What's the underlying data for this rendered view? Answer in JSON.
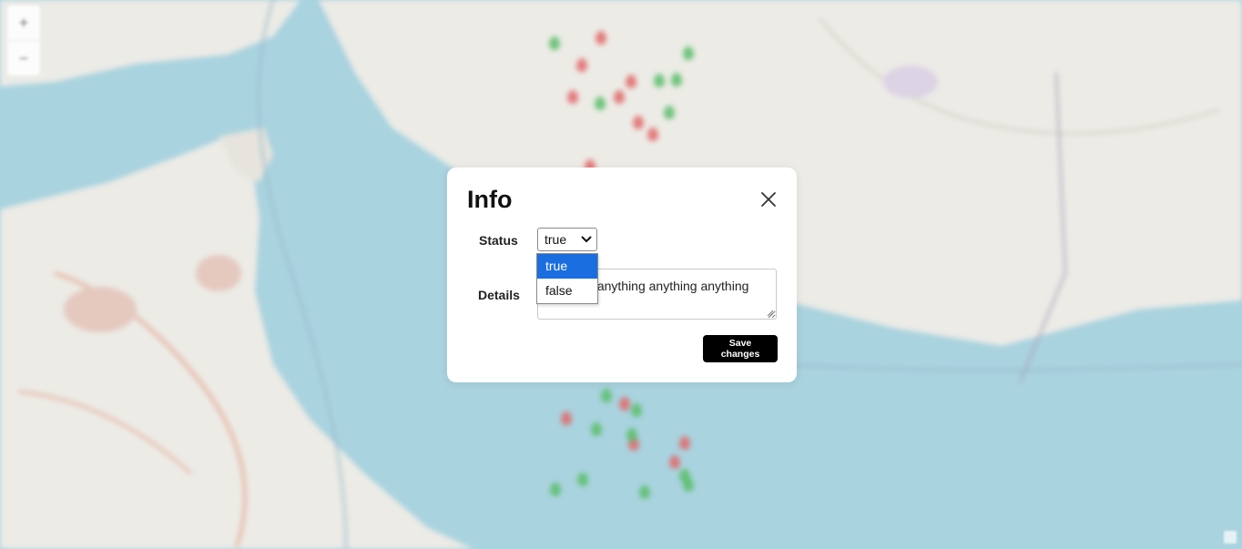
{
  "map": {
    "zoom_in_label": "+",
    "zoom_out_label": "−",
    "markers": [
      {
        "color": "green"
      },
      {
        "color": "red"
      },
      {
        "color": "red"
      },
      {
        "color": "green"
      },
      {
        "color": "red"
      },
      {
        "color": "green"
      },
      {
        "color": "green"
      },
      {
        "color": "red"
      },
      {
        "color": "green"
      },
      {
        "color": "red"
      },
      {
        "color": "green"
      },
      {
        "color": "red"
      },
      {
        "color": "red"
      },
      {
        "color": "green"
      },
      {
        "color": "red"
      },
      {
        "color": "green"
      },
      {
        "color": "red"
      },
      {
        "color": "green"
      },
      {
        "color": "red"
      },
      {
        "color": "green"
      },
      {
        "color": "red"
      },
      {
        "color": "red"
      },
      {
        "color": "red"
      },
      {
        "color": "green"
      },
      {
        "color": "green"
      },
      {
        "color": "green"
      },
      {
        "color": "green"
      },
      {
        "color": "green"
      }
    ],
    "colors": {
      "water": "#a9d3df",
      "land": "#ecebe6",
      "green_marker": "#5bbd6a",
      "red_marker": "#e26a6a"
    }
  },
  "modal": {
    "title": "Info",
    "close_icon": "close-icon",
    "status_label": "Status",
    "status_value": "true",
    "status_options": [
      "true",
      "false"
    ],
    "details_label": "Details",
    "details_value": "anything anything anything anything",
    "save_label": "Save changes"
  }
}
